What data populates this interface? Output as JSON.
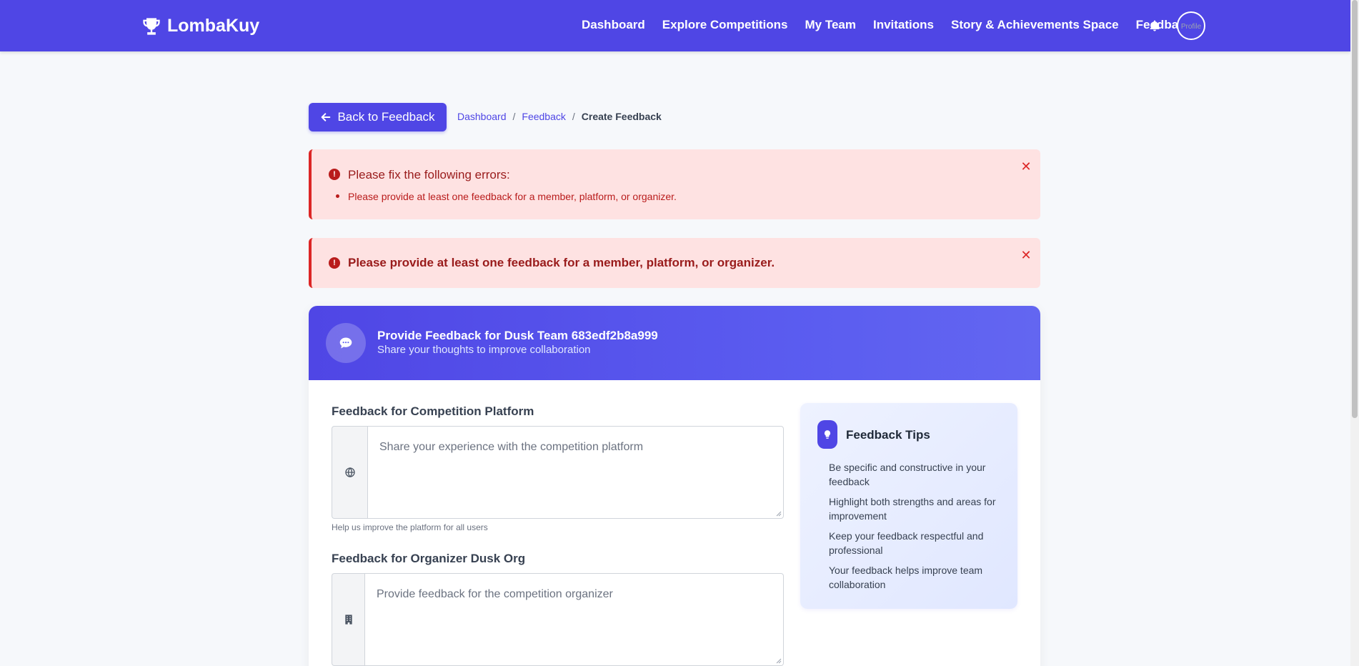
{
  "navbar": {
    "brand": "LombaKuy",
    "links": [
      "Dashboard",
      "Explore Competitions",
      "My Team",
      "Invitations",
      "Story & Achievements Space",
      "Feedback"
    ],
    "avatar_alt": "Profile"
  },
  "toolbar": {
    "back_label": "Back to Feedback"
  },
  "breadcrumb": {
    "items": [
      "Dashboard",
      "Feedback"
    ],
    "current": "Create Feedback",
    "separator": "/"
  },
  "alerts": [
    {
      "title": "Please fix the following errors:",
      "items": [
        "Please provide at least one feedback for a member, platform, or organizer."
      ]
    },
    {
      "title": "Please provide at least one feedback for a member, platform, or organizer."
    }
  ],
  "card": {
    "title": "Provide Feedback for Dusk Team 683edf2b8a999",
    "subtitle": "Share your thoughts to improve collaboration"
  },
  "form": {
    "platform": {
      "label": "Feedback for Competition Platform",
      "placeholder": "Share your experience with the competition platform",
      "help": "Help us improve the platform for all users",
      "value": ""
    },
    "organizer": {
      "label": "Feedback for Organizer Dusk Org",
      "placeholder": "Provide feedback for the competition organizer",
      "value": ""
    }
  },
  "tips": {
    "title": "Feedback Tips",
    "items": [
      "Be specific and constructive in your feedback",
      "Highlight both strengths and areas for improvement",
      "Keep your feedback respectful and professional",
      "Your feedback helps improve team collaboration"
    ]
  },
  "colors": {
    "primary": "#4f46e5",
    "alert_bg": "#fee2e2",
    "alert_text": "#991b1b",
    "page_bg": "#f6f8fb"
  },
  "icons": {
    "brand": "trophy-icon",
    "back": "arrow-left-icon",
    "bell": "bell-icon",
    "alert": "exclamation-circle-icon",
    "close": "close-icon",
    "header": "comment-icon",
    "platform": "globe-icon",
    "organizer": "building-icon",
    "tips": "lightbulb-icon"
  }
}
